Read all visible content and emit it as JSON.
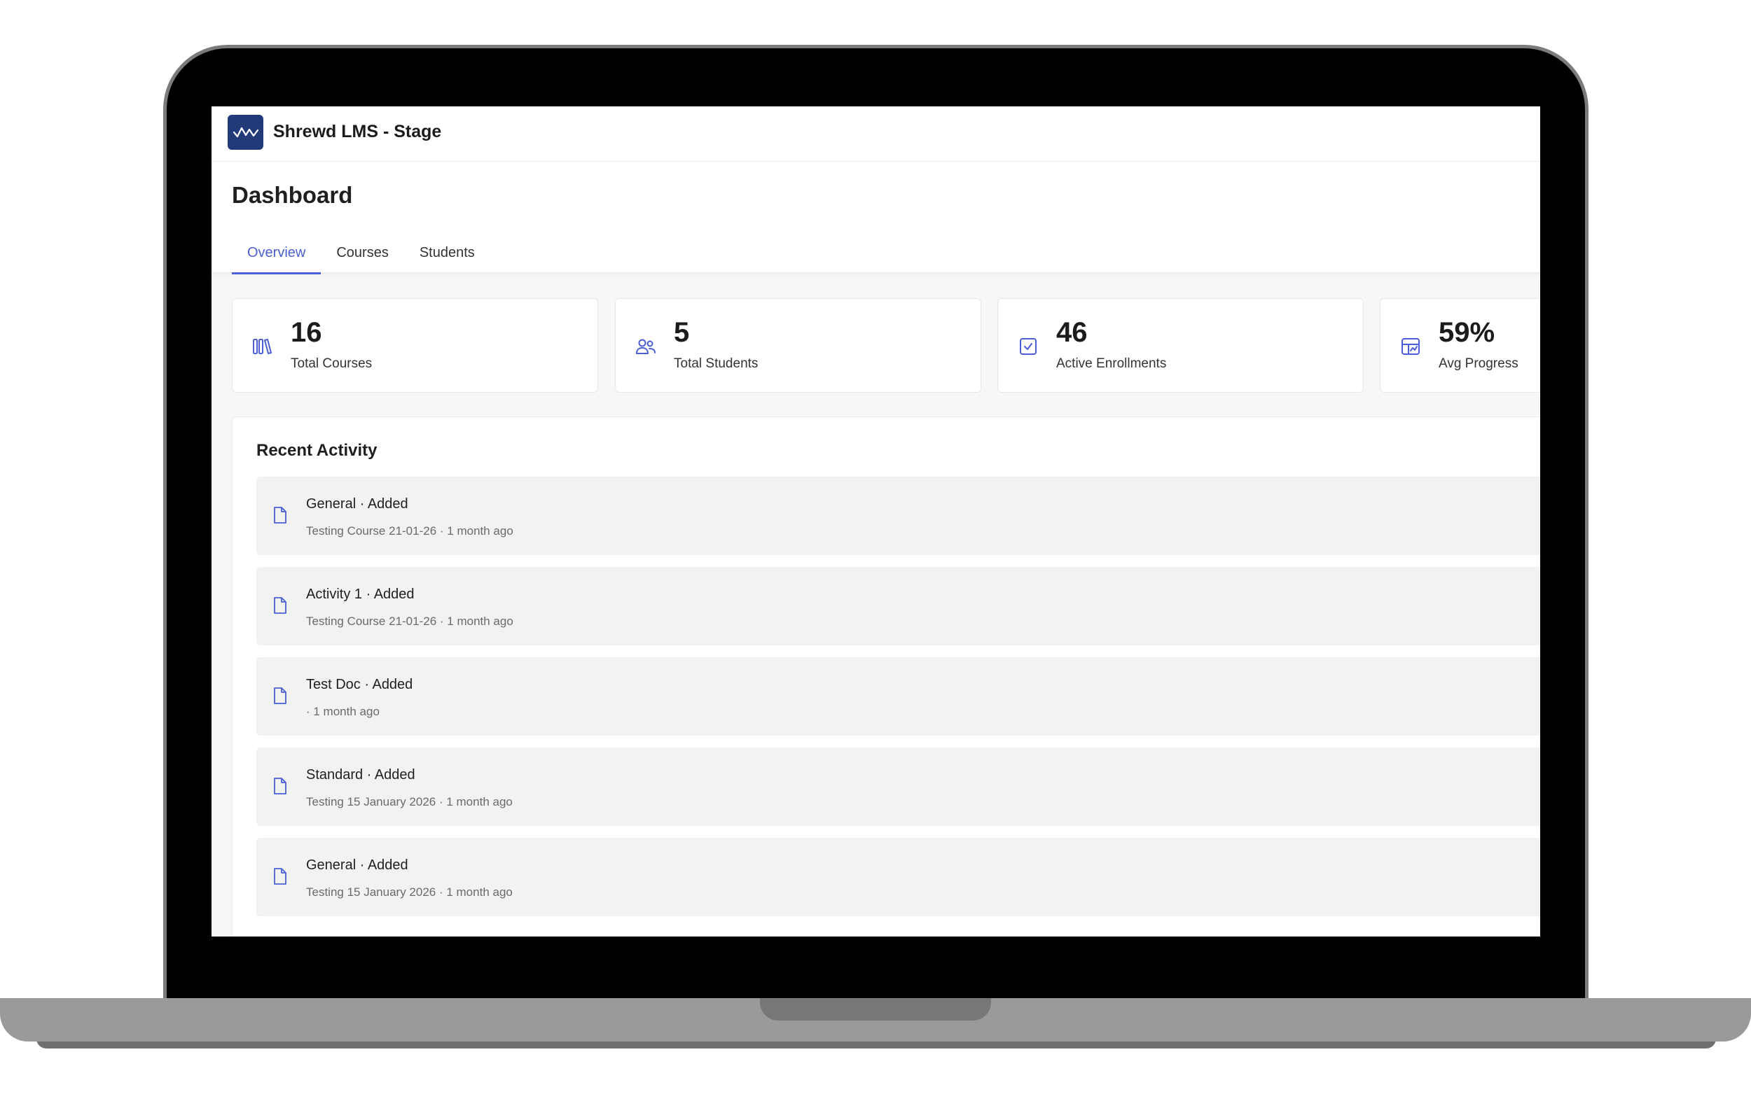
{
  "app": {
    "title": "Shrewd LMS - Stage",
    "logo_icon": "waveform-logo-icon"
  },
  "page": {
    "title": "Dashboard"
  },
  "tabs": [
    {
      "label": "Overview",
      "active": true
    },
    {
      "label": "Courses",
      "active": false
    },
    {
      "label": "Students",
      "active": false
    }
  ],
  "stats": [
    {
      "value": "16",
      "label": "Total Courses",
      "icon": "library-icon"
    },
    {
      "value": "5",
      "label": "Total Students",
      "icon": "users-icon"
    },
    {
      "value": "46",
      "label": "Active Enrollments",
      "icon": "checkbox-icon"
    },
    {
      "value": "59%",
      "label": "Avg Progress",
      "icon": "progress-chart-icon"
    }
  ],
  "recent_activity": {
    "title": "Recent Activity",
    "items": [
      {
        "heading": "General · Added",
        "meta": "Testing Course 21-01-26 · 1 month ago",
        "icon": "document-icon"
      },
      {
        "heading": "Activity 1 · Added",
        "meta": "Testing Course 21-01-26 · 1 month ago",
        "icon": "document-icon"
      },
      {
        "heading": "Test Doc · Added",
        "meta": "· 1 month ago",
        "icon": "document-icon"
      },
      {
        "heading": "Standard · Added",
        "meta": "Testing 15 January 2026 · 1 month ago",
        "icon": "document-icon"
      },
      {
        "heading": "General · Added",
        "meta": "Testing 15 January 2026 · 1 month ago",
        "icon": "document-icon"
      }
    ]
  },
  "colors": {
    "accent": "#4a5fd6",
    "logo_bg": "#233a78",
    "item_bg": "#f2f2f1"
  }
}
